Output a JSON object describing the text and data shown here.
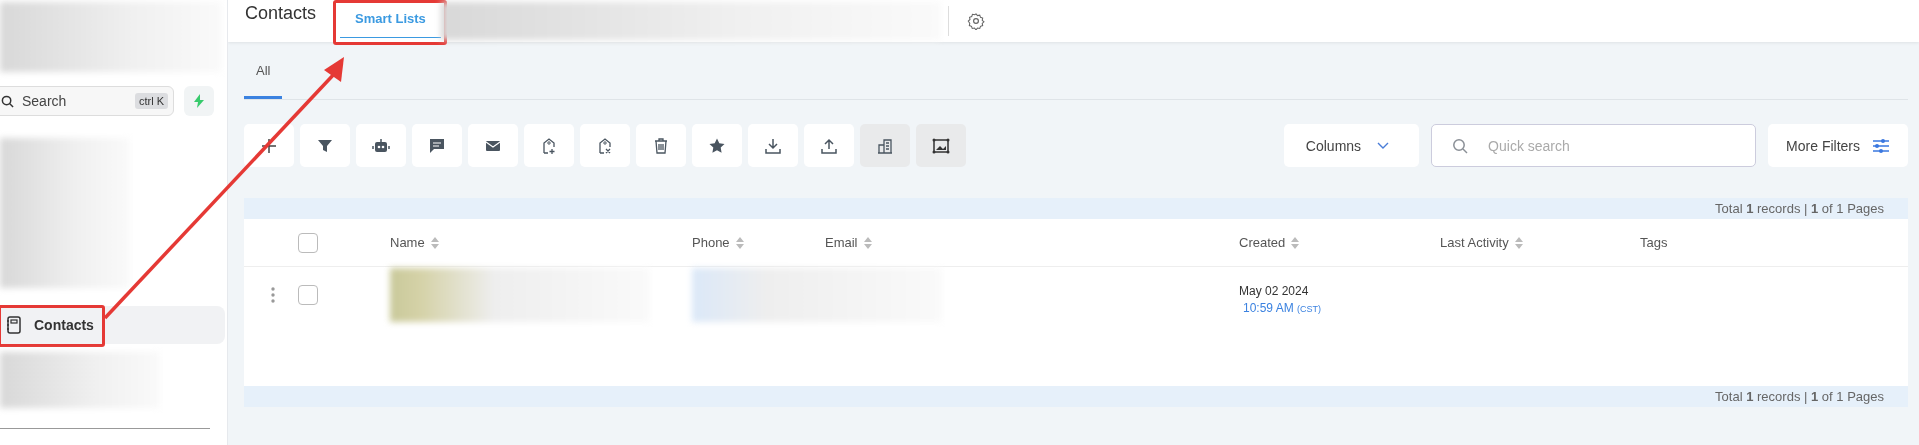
{
  "sidebar": {
    "search": {
      "placeholder": "Search",
      "shortcut": "ctrl K"
    },
    "items": [
      {
        "label": "Contacts",
        "selected": true,
        "highlighted": true
      }
    ]
  },
  "header": {
    "title": "Contacts",
    "tabs": [
      {
        "label": "Smart Lists",
        "selected": true,
        "highlighted": true
      }
    ]
  },
  "list_tabs": [
    {
      "label": "All",
      "selected": true
    }
  ],
  "toolbar": {
    "buttons": [
      {
        "shaded": false
      },
      {
        "shaded": false
      },
      {
        "shaded": false
      },
      {
        "shaded": false
      },
      {
        "shaded": false
      },
      {
        "shaded": false
      },
      {
        "shaded": false
      },
      {
        "shaded": false
      },
      {
        "shaded": false
      },
      {
        "shaded": false
      },
      {
        "shaded": false
      },
      {
        "shaded": true
      },
      {
        "shaded": true
      }
    ],
    "columns_button": "Columns",
    "search": {
      "placeholder": "Quick search"
    },
    "filters_button": "More Filters"
  },
  "table": {
    "summary": "Total **1** records | **1** of 1 Pages",
    "select_all": {
      "checked": false
    },
    "columns": [
      {
        "label": "Name",
        "sortable": true
      },
      {
        "label": "Phone",
        "sortable": true
      },
      {
        "label": "Email",
        "sortable": true
      },
      {
        "label": "Created",
        "sortable": true
      },
      {
        "label": "Last Activity",
        "sortable": true
      },
      {
        "label": "Tags",
        "sortable": false
      }
    ],
    "rows": [
      {
        "checked": false,
        "created_date": "May 02 2024",
        "created_time": "10:59 AM",
        "timezone": "(CST)"
      }
    ],
    "footer": "Total **1** records | **1** of 1 Pages"
  }
}
